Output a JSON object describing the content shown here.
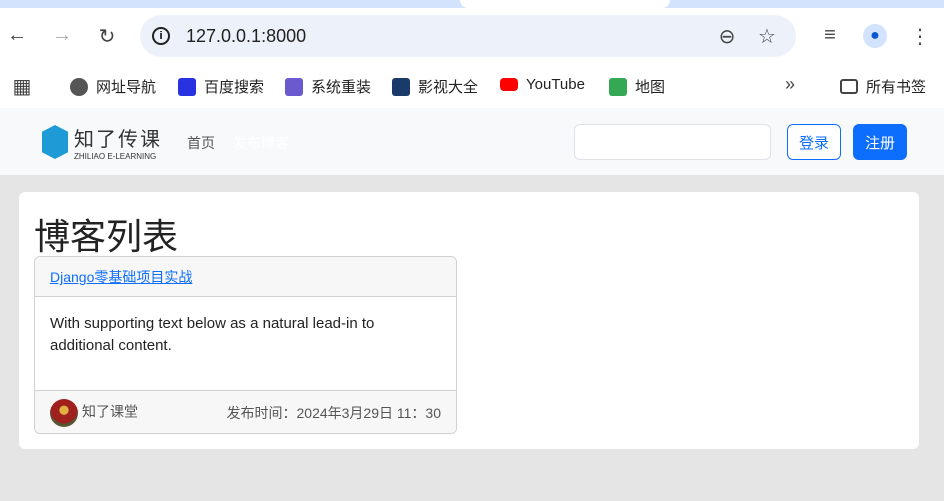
{
  "browser": {
    "url": "127.0.0.1:8000",
    "bookmarks": [
      {
        "label": "网址导航",
        "color": "#555"
      },
      {
        "label": "百度搜索",
        "color": "#2932e1"
      },
      {
        "label": "系统重装",
        "color": "#6a5acd"
      },
      {
        "label": "影视大全",
        "color": "#1a3a6a"
      },
      {
        "label": "YouTube",
        "color": "#ff0000"
      },
      {
        "label": "地图",
        "color": "#34a853"
      }
    ],
    "all_bookmarks": "所有书签"
  },
  "navbar": {
    "brand": "知了传课",
    "brand_sub": "ZHILIAO E-LEARNING",
    "links": [
      "首页",
      "发布博客"
    ],
    "search_placeholder": "",
    "login": "登录",
    "register": "注册",
    "accent": "#0d6efd"
  },
  "main": {
    "title": "博客列表",
    "cards": [
      {
        "title": "Django零基础项目实战",
        "body": "With supporting text below as a natural lead-in to additional content.",
        "author": "知了课堂",
        "published": "发布时间：2024年3月29日 11：30"
      }
    ]
  }
}
